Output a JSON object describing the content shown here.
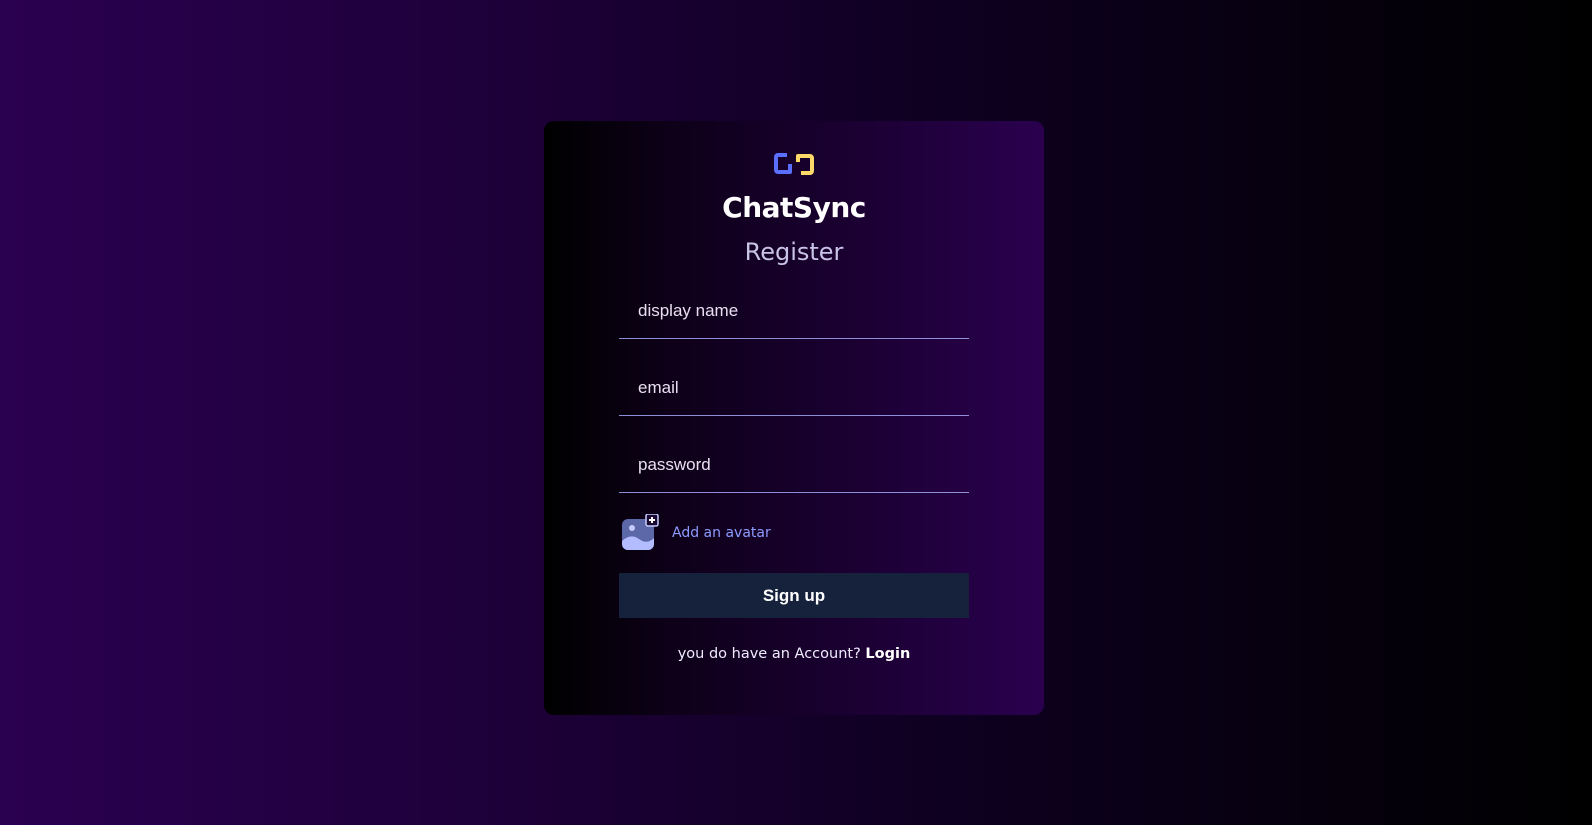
{
  "brand": {
    "logo_icon": "chat-sync-logo-icon",
    "app_name": "ChatSync",
    "colors": {
      "logo_blue": "#5b6fff",
      "logo_yellow": "#ffd86a"
    }
  },
  "register_form": {
    "title": "Register",
    "display_name_placeholder": "display name",
    "email_placeholder": "email",
    "password_placeholder": "password",
    "avatar": {
      "icon": "add-image-icon",
      "label": "Add an avatar"
    },
    "submit_label": "Sign up",
    "footer_prompt": "you do have an Account?",
    "login_link": "Login"
  }
}
